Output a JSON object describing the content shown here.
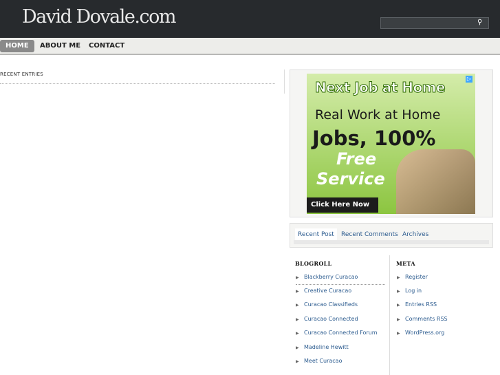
{
  "header": {
    "site_title": "David Dovale.com",
    "search_placeholder": ""
  },
  "nav": {
    "items": [
      "HOME",
      "ABOUT ME",
      "CONTACT"
    ]
  },
  "main": {
    "recent_entries_title": "RECENT ENTRIES"
  },
  "ad": {
    "headline": "Next Job at Home",
    "line1": "Real Work at Home",
    "line2": "Jobs, 100%",
    "line3": "Free",
    "line4": "Service",
    "cta": "Click Here Now",
    "badge": "▷"
  },
  "sidebar_tabs": [
    "Recent Post",
    "Recent Comments",
    "Archives"
  ],
  "blogroll": {
    "title": "BLOGROLL",
    "links": [
      "Blackberry Curacao",
      "Creative Curacao",
      "Curacao Classifieds",
      "Curacao Connected",
      "Curacao Connected Forum",
      "Madeline Hewitt",
      "Meet Curacao"
    ]
  },
  "meta": {
    "title": "META",
    "links": [
      "Register",
      "Log in",
      "Entries RSS",
      "Comments RSS",
      "WordPress.org"
    ]
  }
}
